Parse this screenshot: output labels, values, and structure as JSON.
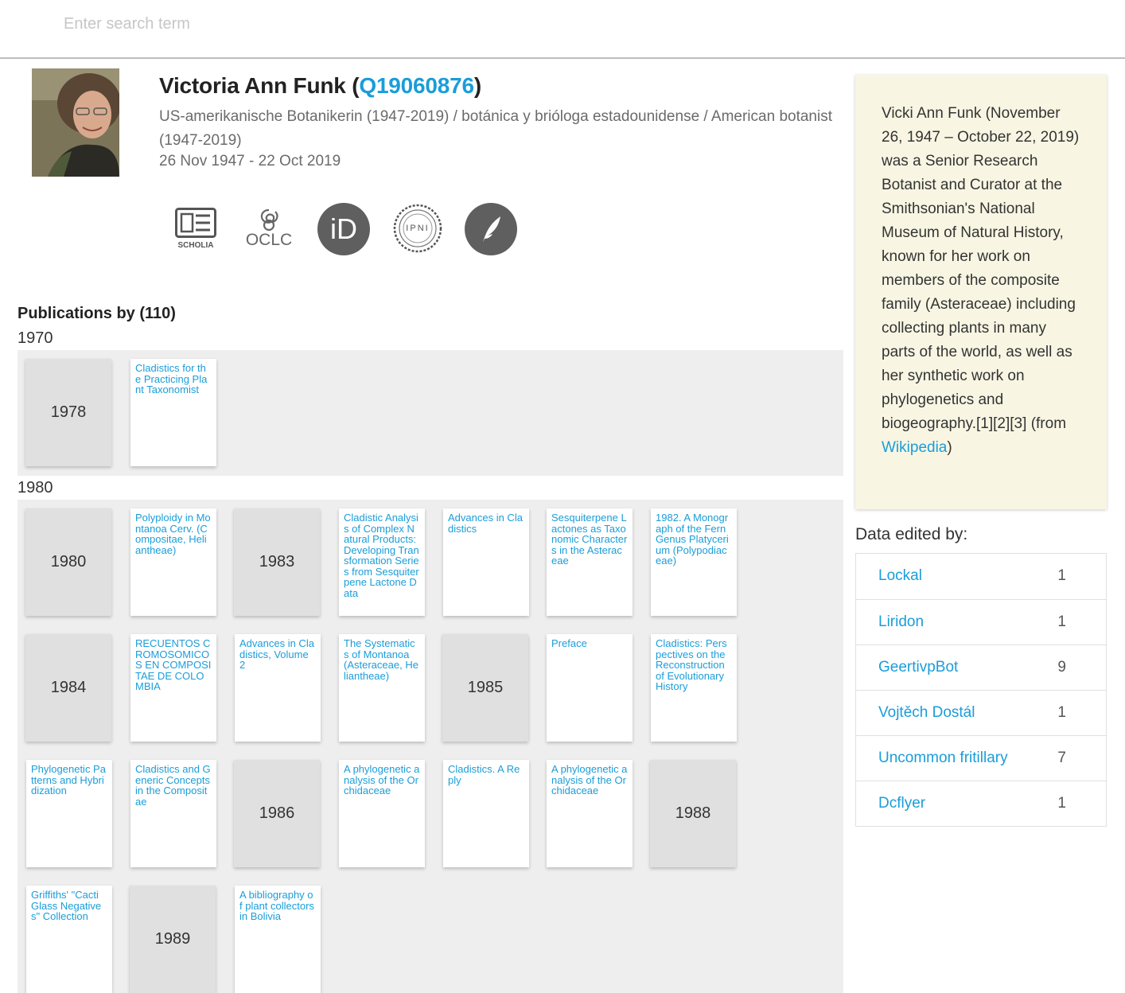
{
  "search": {
    "placeholder": "Enter search term"
  },
  "person": {
    "name": "Victoria Ann Funk",
    "qid": "Q19060876",
    "paren_open": " (",
    "paren_close": ")",
    "description": "US-amerikanische Botanikerin (1947-2019) / botánica y brióloga estadounidense / American botanist (1947-2019)",
    "dates": "26 Nov 1947 - 22 Oct 2019"
  },
  "external_links": {
    "scholia_label": "SCHOLIA",
    "oclc_label": "OCLC",
    "orcid_label": "iD",
    "ipni_label": "IPNI",
    "icons": [
      "scholia-icon",
      "oclc-icon",
      "orcid-icon",
      "ipni-icon",
      "bhl-feather-icon"
    ]
  },
  "publications": {
    "heading": "Publications by (110)",
    "decades": [
      {
        "label": "1970",
        "rows": [
          [
            {
              "type": "year",
              "text": "1978"
            },
            {
              "type": "pub",
              "text": "Cladistics for the Practicing Plant Taxonomist"
            }
          ]
        ]
      },
      {
        "label": "1980",
        "rows": [
          [
            {
              "type": "year",
              "text": "1980"
            },
            {
              "type": "pub",
              "text": "Polyploidy in Montanoa Cerv. (Compositae, Heliantheae)"
            },
            {
              "type": "year",
              "text": "1983"
            },
            {
              "type": "pub",
              "text": "Cladistic Analysis of Complex Natural Products: Developing Transformation Series from Sesquiterpene Lactone Data"
            },
            {
              "type": "pub",
              "text": "Advances in Cladistics"
            },
            {
              "type": "pub",
              "text": "Sesquiterpene Lactones as Taxonomic Characters in the Asteraceae"
            },
            {
              "type": "pub",
              "text": "1982. A Monograph of the Fern Genus Platycerium (Polypodiaceae)"
            }
          ],
          [
            {
              "type": "year",
              "text": "1984"
            },
            {
              "type": "pub",
              "text": "RECUENTOS CROMOSOMICOS EN COMPOSITAE DE COLOMBIA"
            },
            {
              "type": "pub",
              "text": "Advances in Cladistics, Volume 2"
            },
            {
              "type": "pub",
              "text": "The Systematics of Montanoa (Asteraceae, Heliantheae)"
            },
            {
              "type": "year",
              "text": "1985"
            },
            {
              "type": "pub",
              "text": "Preface"
            },
            {
              "type": "pub",
              "text": "Cladistics: Perspectives on the Reconstruction of Evolutionary History"
            }
          ],
          [
            {
              "type": "pub",
              "text": "Phylogenetic Patterns and Hybridization"
            },
            {
              "type": "pub",
              "text": "Cladistics and Generic Concepts in the Compositae"
            },
            {
              "type": "year",
              "text": "1986"
            },
            {
              "type": "pub",
              "text": "A phylogenetic analysis of the Orchidaceae"
            },
            {
              "type": "pub",
              "text": "Cladistics. A Reply"
            },
            {
              "type": "pub",
              "text": "A phylogenetic analysis of the Orchidaceae"
            },
            {
              "type": "year",
              "text": "1988"
            }
          ],
          [
            {
              "type": "pub",
              "text": "Griffiths' \"Cacti Glass Negatives\" Collection"
            },
            {
              "type": "year",
              "text": "1989"
            },
            {
              "type": "pub",
              "text": "A bibliography of plant collectors in Bolivia"
            }
          ]
        ]
      }
    ]
  },
  "summary": {
    "text": "Vicki Ann Funk (November 26, 1947 – October 22, 2019) was a Senior Research Botanist and Curator at the Smithsonian's National Museum of Natural History, known for her work on members of the composite family (Asteraceae) including collecting plants in many parts of the world, as well as her synthetic work on phylogenetics and biogeography.[1][2][3]",
    "from_prefix": "(from ",
    "link_label": "Wikipedia",
    "from_suffix": ")"
  },
  "editors": {
    "heading": "Data edited by:",
    "rows": [
      {
        "name": "Lockal",
        "count": "1"
      },
      {
        "name": "Liridon",
        "count": "1"
      },
      {
        "name": "GeertivpBot",
        "count": "9"
      },
      {
        "name": "Vojtěch Dostál",
        "count": "1"
      },
      {
        "name": "Uncommon fritillary",
        "count": "7"
      },
      {
        "name": "Dcflyer",
        "count": "1"
      }
    ]
  },
  "colors": {
    "link": "#1a9dd9",
    "summary_bg": "#f8f6e3",
    "decade_bg": "#eeeeee",
    "year_card_bg": "#e0e0e0"
  }
}
